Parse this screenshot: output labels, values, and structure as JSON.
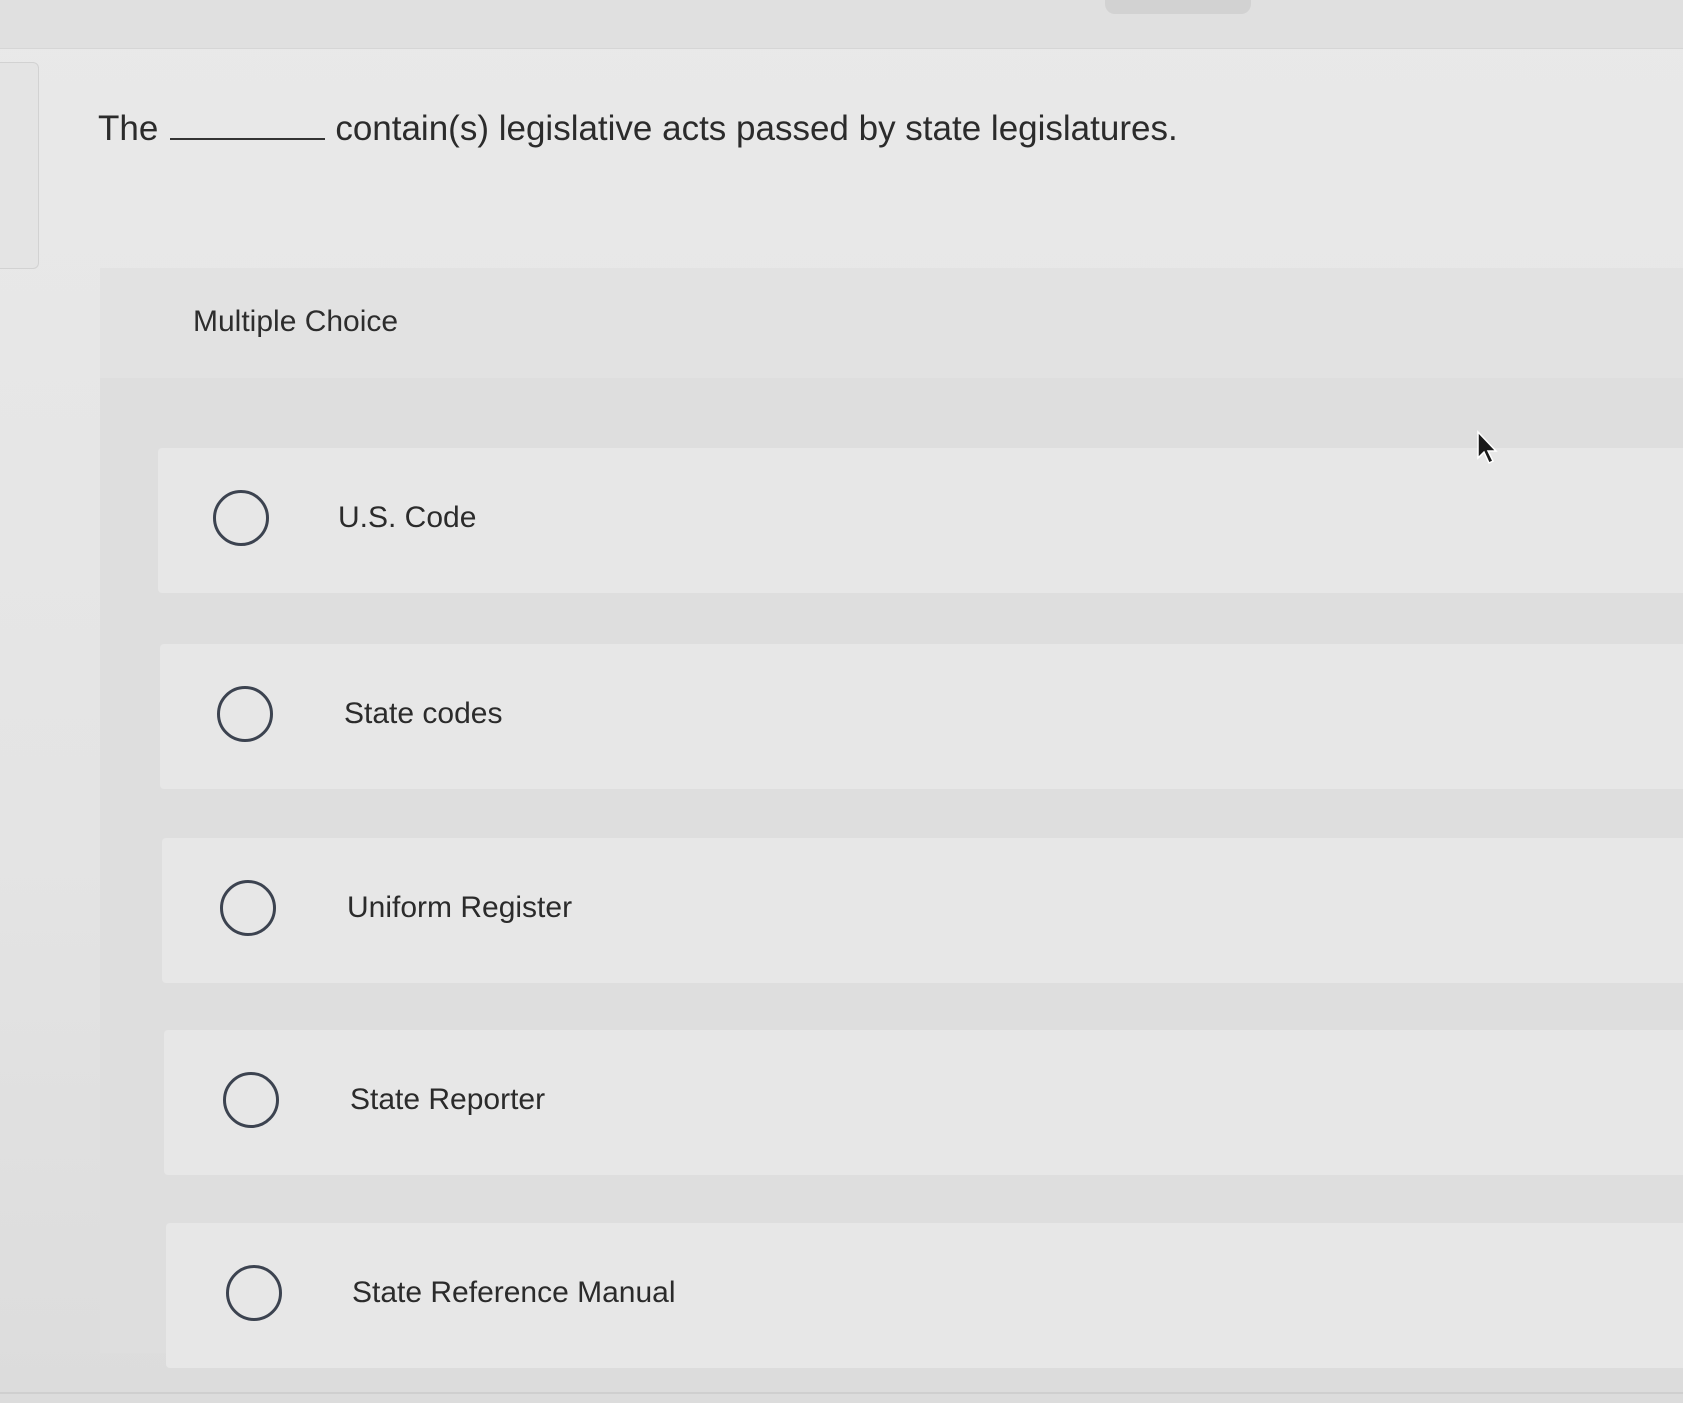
{
  "question": {
    "prefix": "The",
    "suffix": "contain(s) legislative acts passed by state legislatures."
  },
  "panel": {
    "label": "Multiple Choice"
  },
  "options": [
    {
      "label": "U.S. Code"
    },
    {
      "label": "State codes"
    },
    {
      "label": "Uniform Register"
    },
    {
      "label": "State Reporter"
    },
    {
      "label": "State Reference Manual"
    }
  ],
  "colors": {
    "background": "#e6e6e6",
    "radio_border": "#3c4350",
    "text": "#2b2b2b"
  },
  "icons": {
    "cursor": "mouse-pointer-icon",
    "radio": "radio-circle-icon"
  }
}
